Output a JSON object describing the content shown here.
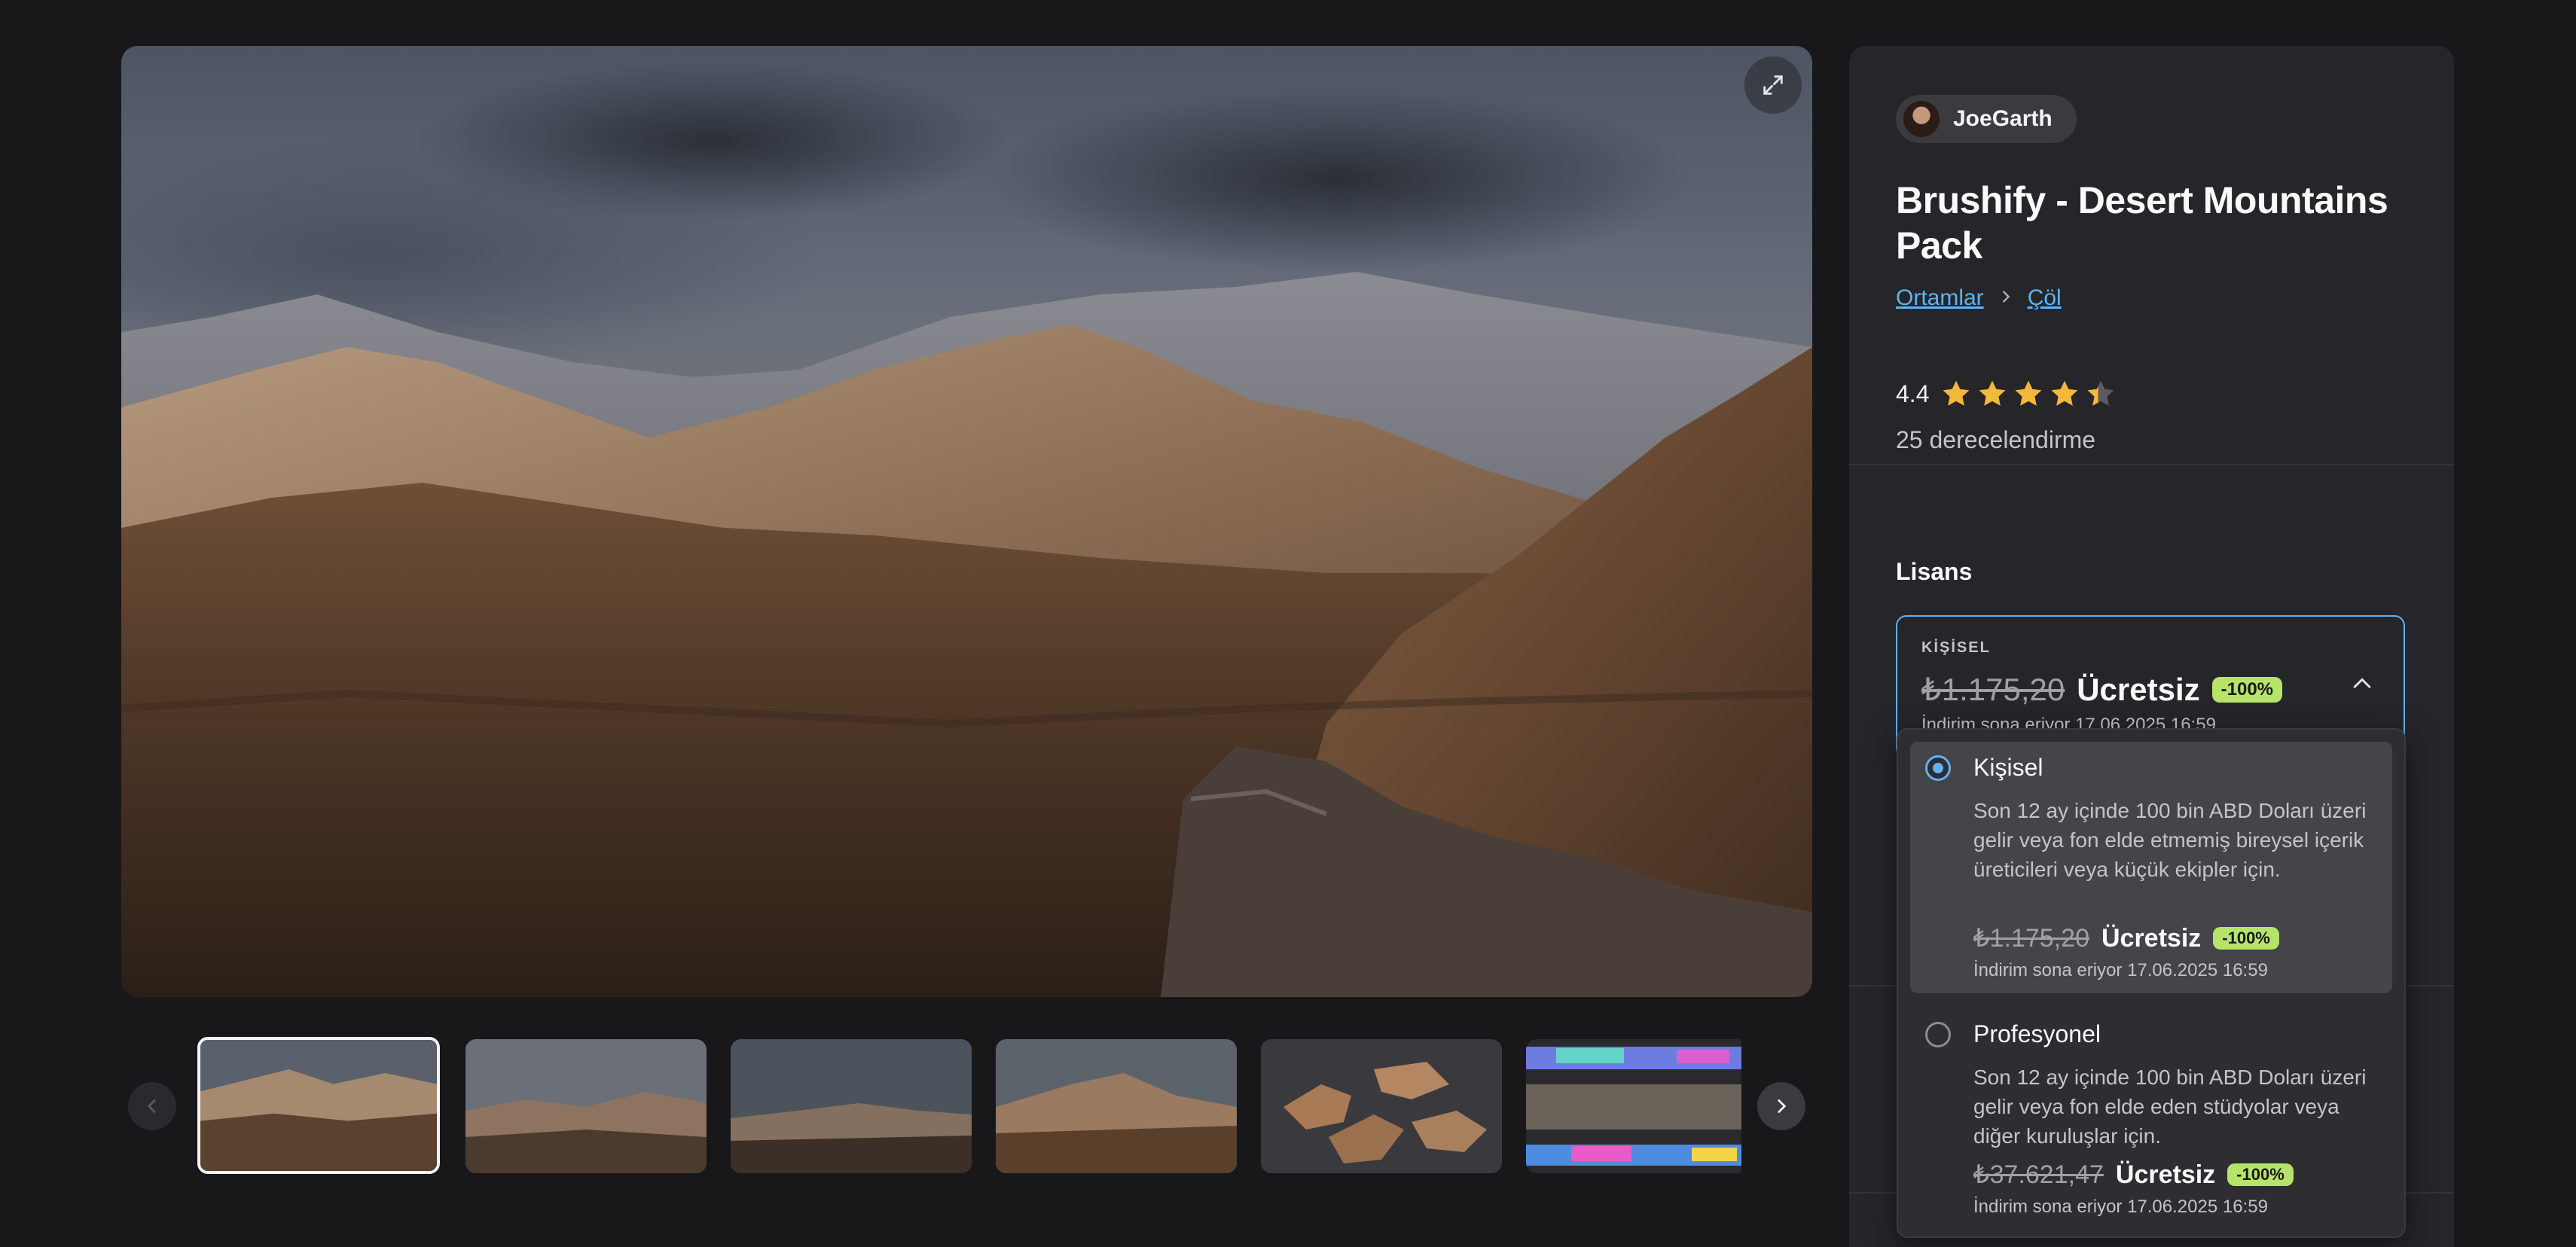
{
  "seller": {
    "name": "JoeGarth"
  },
  "product": {
    "title": "Brushify - Desert Mountains Pack"
  },
  "breadcrumb": [
    {
      "label": "Ortamlar"
    },
    {
      "label": "Çöl"
    }
  ],
  "rating": {
    "score": "4.4",
    "value": 4.4,
    "max": 5,
    "count_label": "25 derecelendirme"
  },
  "license": {
    "heading": "Lisans",
    "selected": {
      "caption": "KİŞİSEL",
      "old_price": "₺1.175,20",
      "new_price": "Ücretsiz",
      "discount": "-100%",
      "ends": "İndirim sona eriyor 17.06.2025 16:59"
    },
    "options": [
      {
        "title": "Kişisel",
        "selected": true,
        "description": "Son 12 ay içinde 100 bin ABD Doları üzeri gelir veya fon elde etmemiş bireysel içerik üreticileri veya küçük ekipler için.",
        "old_price": "₺1.175,20",
        "new_price": "Ücretsiz",
        "discount": "-100%",
        "ends": "İndirim sona eriyor 17.06.2025 16:59"
      },
      {
        "title": "Profesyonel",
        "selected": false,
        "description": "Son 12 ay içinde 100 bin ABD Doları üzeri gelir veya fon elde eden stüdyolar veya diğer kuruluşlar için.",
        "old_price": "₺37.621,47",
        "new_price": "Ücretsiz",
        "discount": "-100%",
        "ends": "İndirim sona eriyor 17.06.2025 16:59"
      }
    ]
  },
  "gallery": {
    "thumbnail_count": 6,
    "active_index": 0
  },
  "icons": {
    "expand": "expand-icon",
    "prev": "chevron-left-icon",
    "next": "chevron-right-icon",
    "breadcrumb_separator": "chevron-right-icon",
    "dropdown_toggle": "chevron-up-icon",
    "star": "star-icon"
  },
  "colors": {
    "accent": "#5eb3f5",
    "badge": "#b6e36a",
    "star": "#f5b93a",
    "panel": "#26262a",
    "background": "#18181b"
  }
}
